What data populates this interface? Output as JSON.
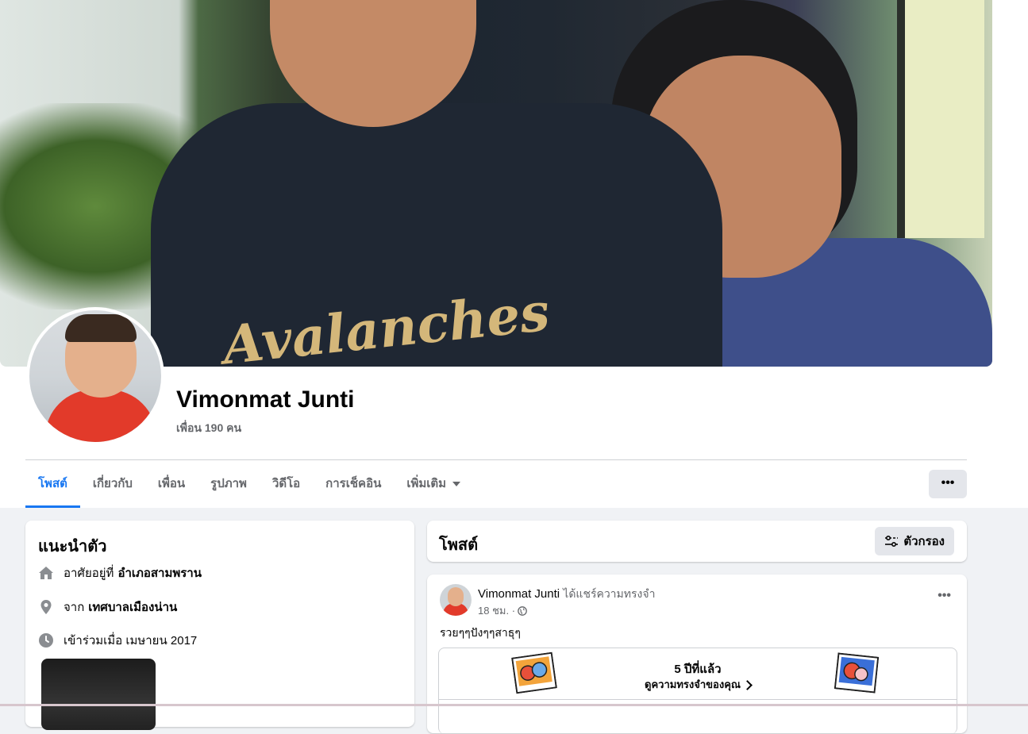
{
  "profile": {
    "name": "Vimonmat Junti",
    "friends": "เพื่อน 190 คน"
  },
  "tabs": [
    {
      "label": "โพสต์",
      "active": true
    },
    {
      "label": "เกี่ยวกับ",
      "active": false
    },
    {
      "label": "เพื่อน",
      "active": false
    },
    {
      "label": "รูปภาพ",
      "active": false
    },
    {
      "label": "วิดีโอ",
      "active": false
    },
    {
      "label": "การเช็คอิน",
      "active": false
    },
    {
      "label": "เพิ่มเติม",
      "active": false
    }
  ],
  "more_button": "•••",
  "intro": {
    "title": "แนะนำตัว",
    "lives_prefix": "อาศัยอยู่ที่",
    "lives_value": "อำเภอสามพราน",
    "from_prefix": "จาก",
    "from_value": "เทศบาลเมืองน่าน",
    "joined": "เข้าร่วมเมื่อ เมษายน 2017"
  },
  "posts": {
    "title": "โพสต์",
    "filter_label": "ตัวกรอง"
  },
  "post": {
    "author": "Vimonmat Junti",
    "action": "ได้แชร์ความทรงจำ",
    "time": "18 ชม. ·",
    "options": "•••",
    "text": "รวยๆๆปังๆๆสาธุๆ",
    "memory_years": "5 ปีที่แล้ว",
    "memory_link": "ดูความทรงจำของคุณ"
  },
  "colors": {
    "accent": "#1877f2",
    "background": "#f0f2f5",
    "secondary_text": "#65676b"
  }
}
